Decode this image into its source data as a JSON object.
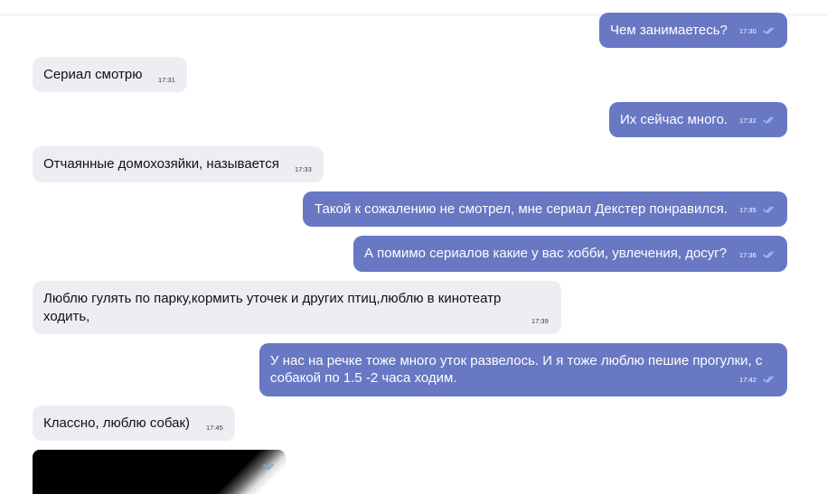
{
  "theme": {
    "outgoing_color": "#6878c3",
    "incoming_color": "#eceef4",
    "read_check_color": "#a9c4f5"
  },
  "messages": [
    {
      "direction": "out",
      "text": "Чем занимаетесь?",
      "time": "17:30",
      "status": "read"
    },
    {
      "direction": "in",
      "text": "Сериал смотрю",
      "time": "17:31"
    },
    {
      "direction": "out",
      "text": "Их сейчас много.",
      "time": "17:32",
      "status": "read"
    },
    {
      "direction": "in",
      "text": "Отчаянные домохозяйки, называется",
      "time": "17:33"
    },
    {
      "direction": "out",
      "text": "Такой к сожалению не смотрел, мне сериал Декстер понравился.",
      "time": "17:35",
      "status": "read"
    },
    {
      "direction": "out",
      "text": "А помимо сериалов какие у вас хобби, увлечения, досуг?",
      "time": "17:36",
      "status": "read"
    },
    {
      "direction": "in",
      "text_lines": [
        "Люблю гулять по парку,кормить уточек и других птиц,люблю в кинотеатр",
        "ходить,"
      ],
      "time": "17:39"
    },
    {
      "direction": "out",
      "text_lines": [
        "У нас на речке тоже много уток развелось. И я тоже люблю пешие прогулки, с",
        "собакой по 1.5 -2 часа ходим."
      ],
      "time": "17:42",
      "status": "read"
    },
    {
      "direction": "in",
      "text": "Классно, люблю собак)",
      "time": "17:45"
    }
  ],
  "media_message": {
    "direction": "in",
    "menu_icon": "chevron-down-icon"
  }
}
